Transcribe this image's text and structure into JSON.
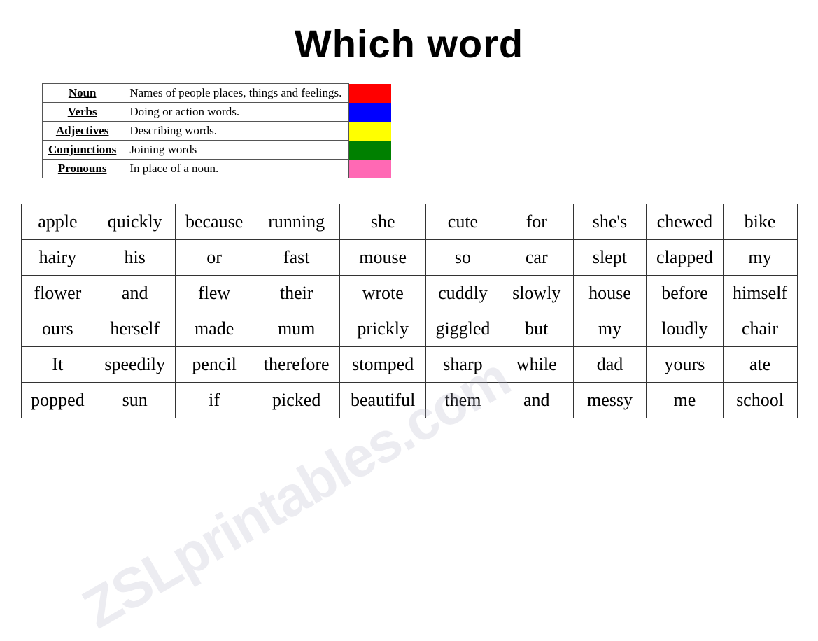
{
  "title": "Which word",
  "legend": {
    "rows": [
      {
        "name": "Noun",
        "description": "Names of people places, things and feelings.",
        "color": "#FF0000"
      },
      {
        "name": "Verbs",
        "description": "Doing or action words.",
        "color": "#0000FF"
      },
      {
        "name": "Adjectives",
        "description": "Describing words.",
        "color": "#FFFF00"
      },
      {
        "name": "Conjunctions",
        "description": "Joining words",
        "color": "#008000"
      },
      {
        "name": "Pronouns",
        "description": "In place of a noun.",
        "color": "#FF69B4"
      }
    ]
  },
  "grid": {
    "rows": [
      [
        "apple",
        "quickly",
        "because",
        "running",
        "she",
        "cute",
        "for",
        "she's",
        "chewed",
        "bike"
      ],
      [
        "hairy",
        "his",
        "or",
        "fast",
        "mouse",
        "so",
        "car",
        "slept",
        "clapped",
        "my"
      ],
      [
        "flower",
        "and",
        "flew",
        "their",
        "wrote",
        "cuddly",
        "slowly",
        "house",
        "before",
        "himself"
      ],
      [
        "ours",
        "herself",
        "made",
        "mum",
        "prickly",
        "giggled",
        "but",
        "my",
        "loudly",
        "chair"
      ],
      [
        "It",
        "speedily",
        "pencil",
        "therefore",
        "stomped",
        "sharp",
        "while",
        "dad",
        "yours",
        "ate"
      ],
      [
        "popped",
        "sun",
        "if",
        "picked",
        "beautiful",
        "them",
        "and",
        "messy",
        "me",
        "school"
      ]
    ]
  },
  "watermark": "ZSLprintables.com"
}
